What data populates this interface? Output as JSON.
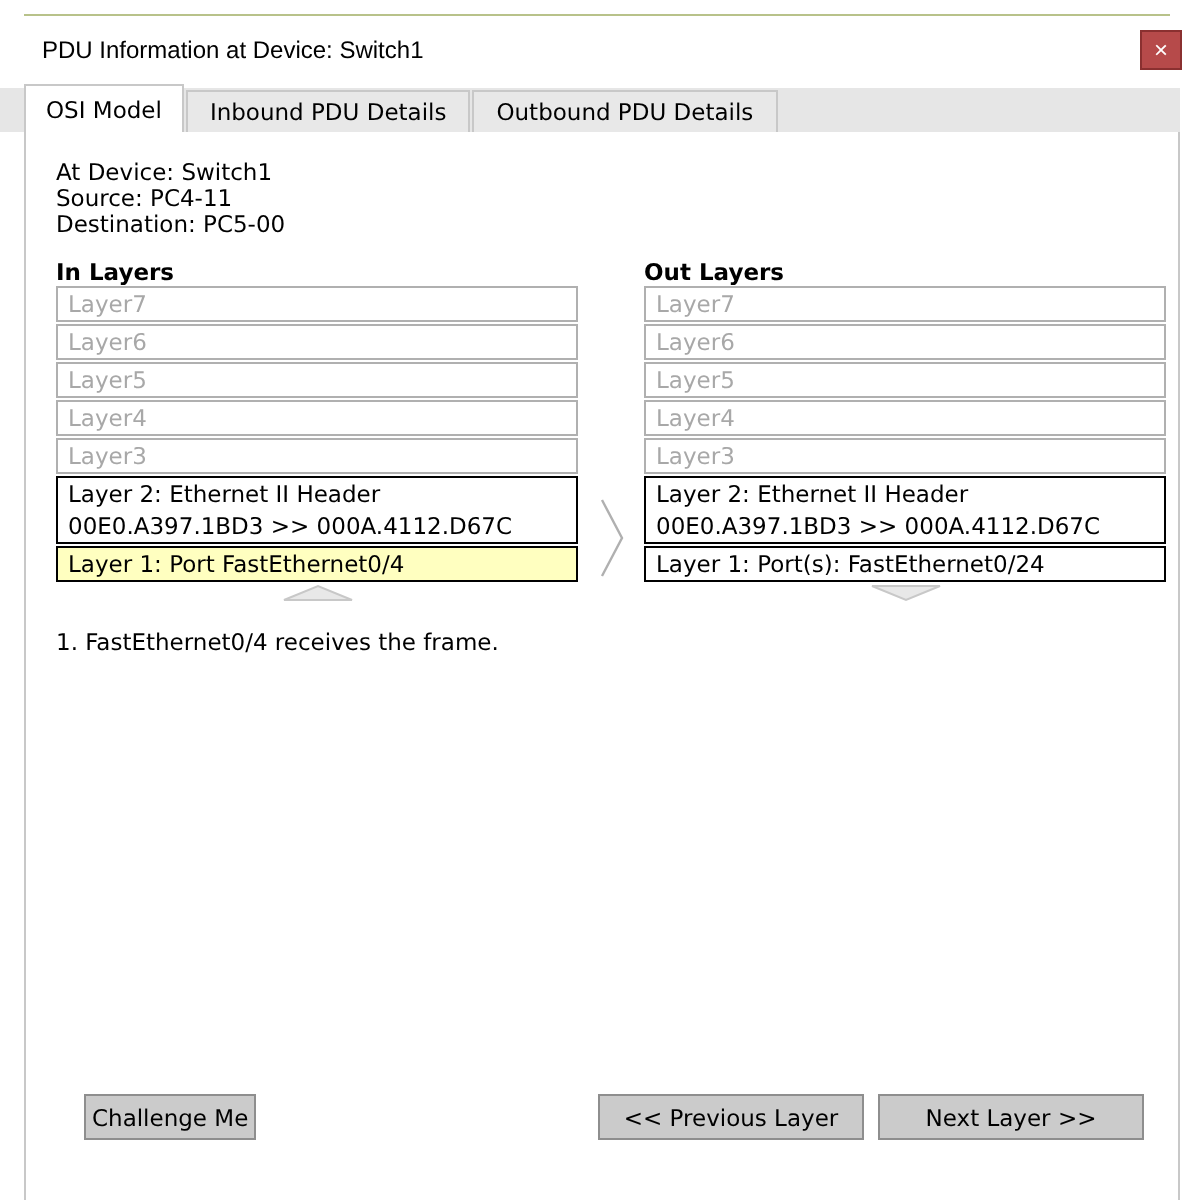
{
  "window": {
    "title": "PDU Information at Device: Switch1",
    "close": "×"
  },
  "tabs": [
    {
      "label": "OSI Model",
      "selected": true
    },
    {
      "label": "Inbound PDU Details",
      "selected": false
    },
    {
      "label": "Outbound PDU Details",
      "selected": false
    }
  ],
  "info": [
    "At Device: Switch1",
    "Source: PC4-11",
    "Destination: PC5-00"
  ],
  "in_layers": {
    "title": "In Layers",
    "layers": [
      {
        "lines": [
          "Layer7"
        ],
        "active": false,
        "selected": false
      },
      {
        "lines": [
          "Layer6"
        ],
        "active": false,
        "selected": false
      },
      {
        "lines": [
          "Layer5"
        ],
        "active": false,
        "selected": false
      },
      {
        "lines": [
          "Layer4"
        ],
        "active": false,
        "selected": false
      },
      {
        "lines": [
          "Layer3"
        ],
        "active": false,
        "selected": false
      },
      {
        "lines": [
          "Layer 2: Ethernet II Header",
          "00E0.A397.1BD3 >> 000A.4112.D67C"
        ],
        "active": true,
        "selected": false
      },
      {
        "lines": [
          "Layer 1: Port FastEthernet0/4"
        ],
        "active": true,
        "selected": true
      }
    ]
  },
  "out_layers": {
    "title": "Out Layers",
    "layers": [
      {
        "lines": [
          "Layer7"
        ],
        "active": false,
        "selected": false
      },
      {
        "lines": [
          "Layer6"
        ],
        "active": false,
        "selected": false
      },
      {
        "lines": [
          "Layer5"
        ],
        "active": false,
        "selected": false
      },
      {
        "lines": [
          "Layer4"
        ],
        "active": false,
        "selected": false
      },
      {
        "lines": [
          "Layer3"
        ],
        "active": false,
        "selected": false
      },
      {
        "lines": [
          "Layer 2: Ethernet II Header",
          "00E0.A397.1BD3 >> 000A.4112.D67C"
        ],
        "active": true,
        "selected": false
      },
      {
        "lines": [
          "Layer 1: Port(s): FastEthernet0/24"
        ],
        "active": true,
        "selected": false
      }
    ]
  },
  "description": "1. FastEthernet0/4 receives the frame.",
  "buttons": {
    "challenge": "Challenge Me",
    "previous": "<< Previous Layer",
    "next": "Next Layer >>"
  }
}
